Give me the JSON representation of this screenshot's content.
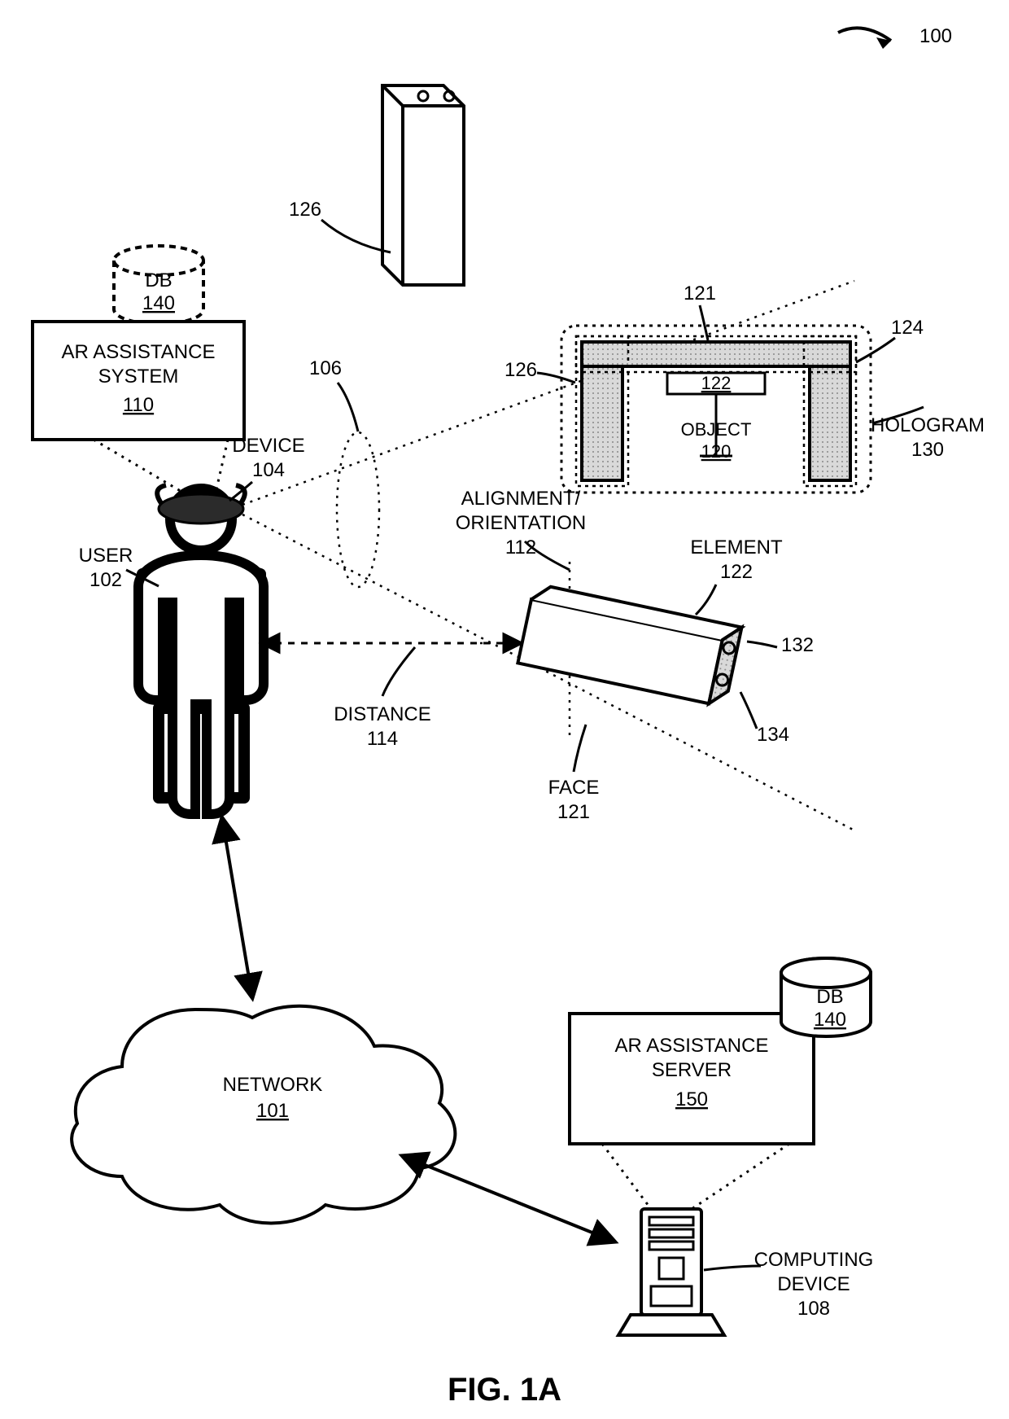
{
  "figure": "FIG. 1A",
  "refTop": "100",
  "db": {
    "label": "DB",
    "num": "140"
  },
  "arSystem": {
    "line1": "AR ASSISTANCE",
    "line2": "SYSTEM",
    "num": "110"
  },
  "device": {
    "label": "DEVICE",
    "num": "104"
  },
  "user": {
    "label": "USER",
    "num": "102"
  },
  "fov": "106",
  "distance": {
    "label": "DISTANCE",
    "num": "114"
  },
  "align": {
    "line1": "ALIGNMENT/",
    "line2": "ORIENTATION",
    "num": "112"
  },
  "element": {
    "label": "ELEMENT",
    "num": "122"
  },
  "face": {
    "label": "FACE",
    "num": "121"
  },
  "hole132": "132",
  "hole134": "134",
  "object": {
    "label": "OBJECT",
    "num": "120"
  },
  "hologram": {
    "label": "HOLOGRAM",
    "num": "130"
  },
  "holoTop121": "121",
  "holoInner122": "122",
  "holo124": "124",
  "holo126left": "126",
  "topBox126": "126",
  "network": {
    "label": "NETWORK",
    "num": "101"
  },
  "arServer": {
    "line1": "AR ASSISTANCE",
    "line2": "SERVER",
    "num": "150"
  },
  "db2": {
    "label": "DB",
    "num": "140"
  },
  "computing": {
    "line1": "COMPUTING",
    "line2": "DEVICE",
    "num": "108"
  }
}
